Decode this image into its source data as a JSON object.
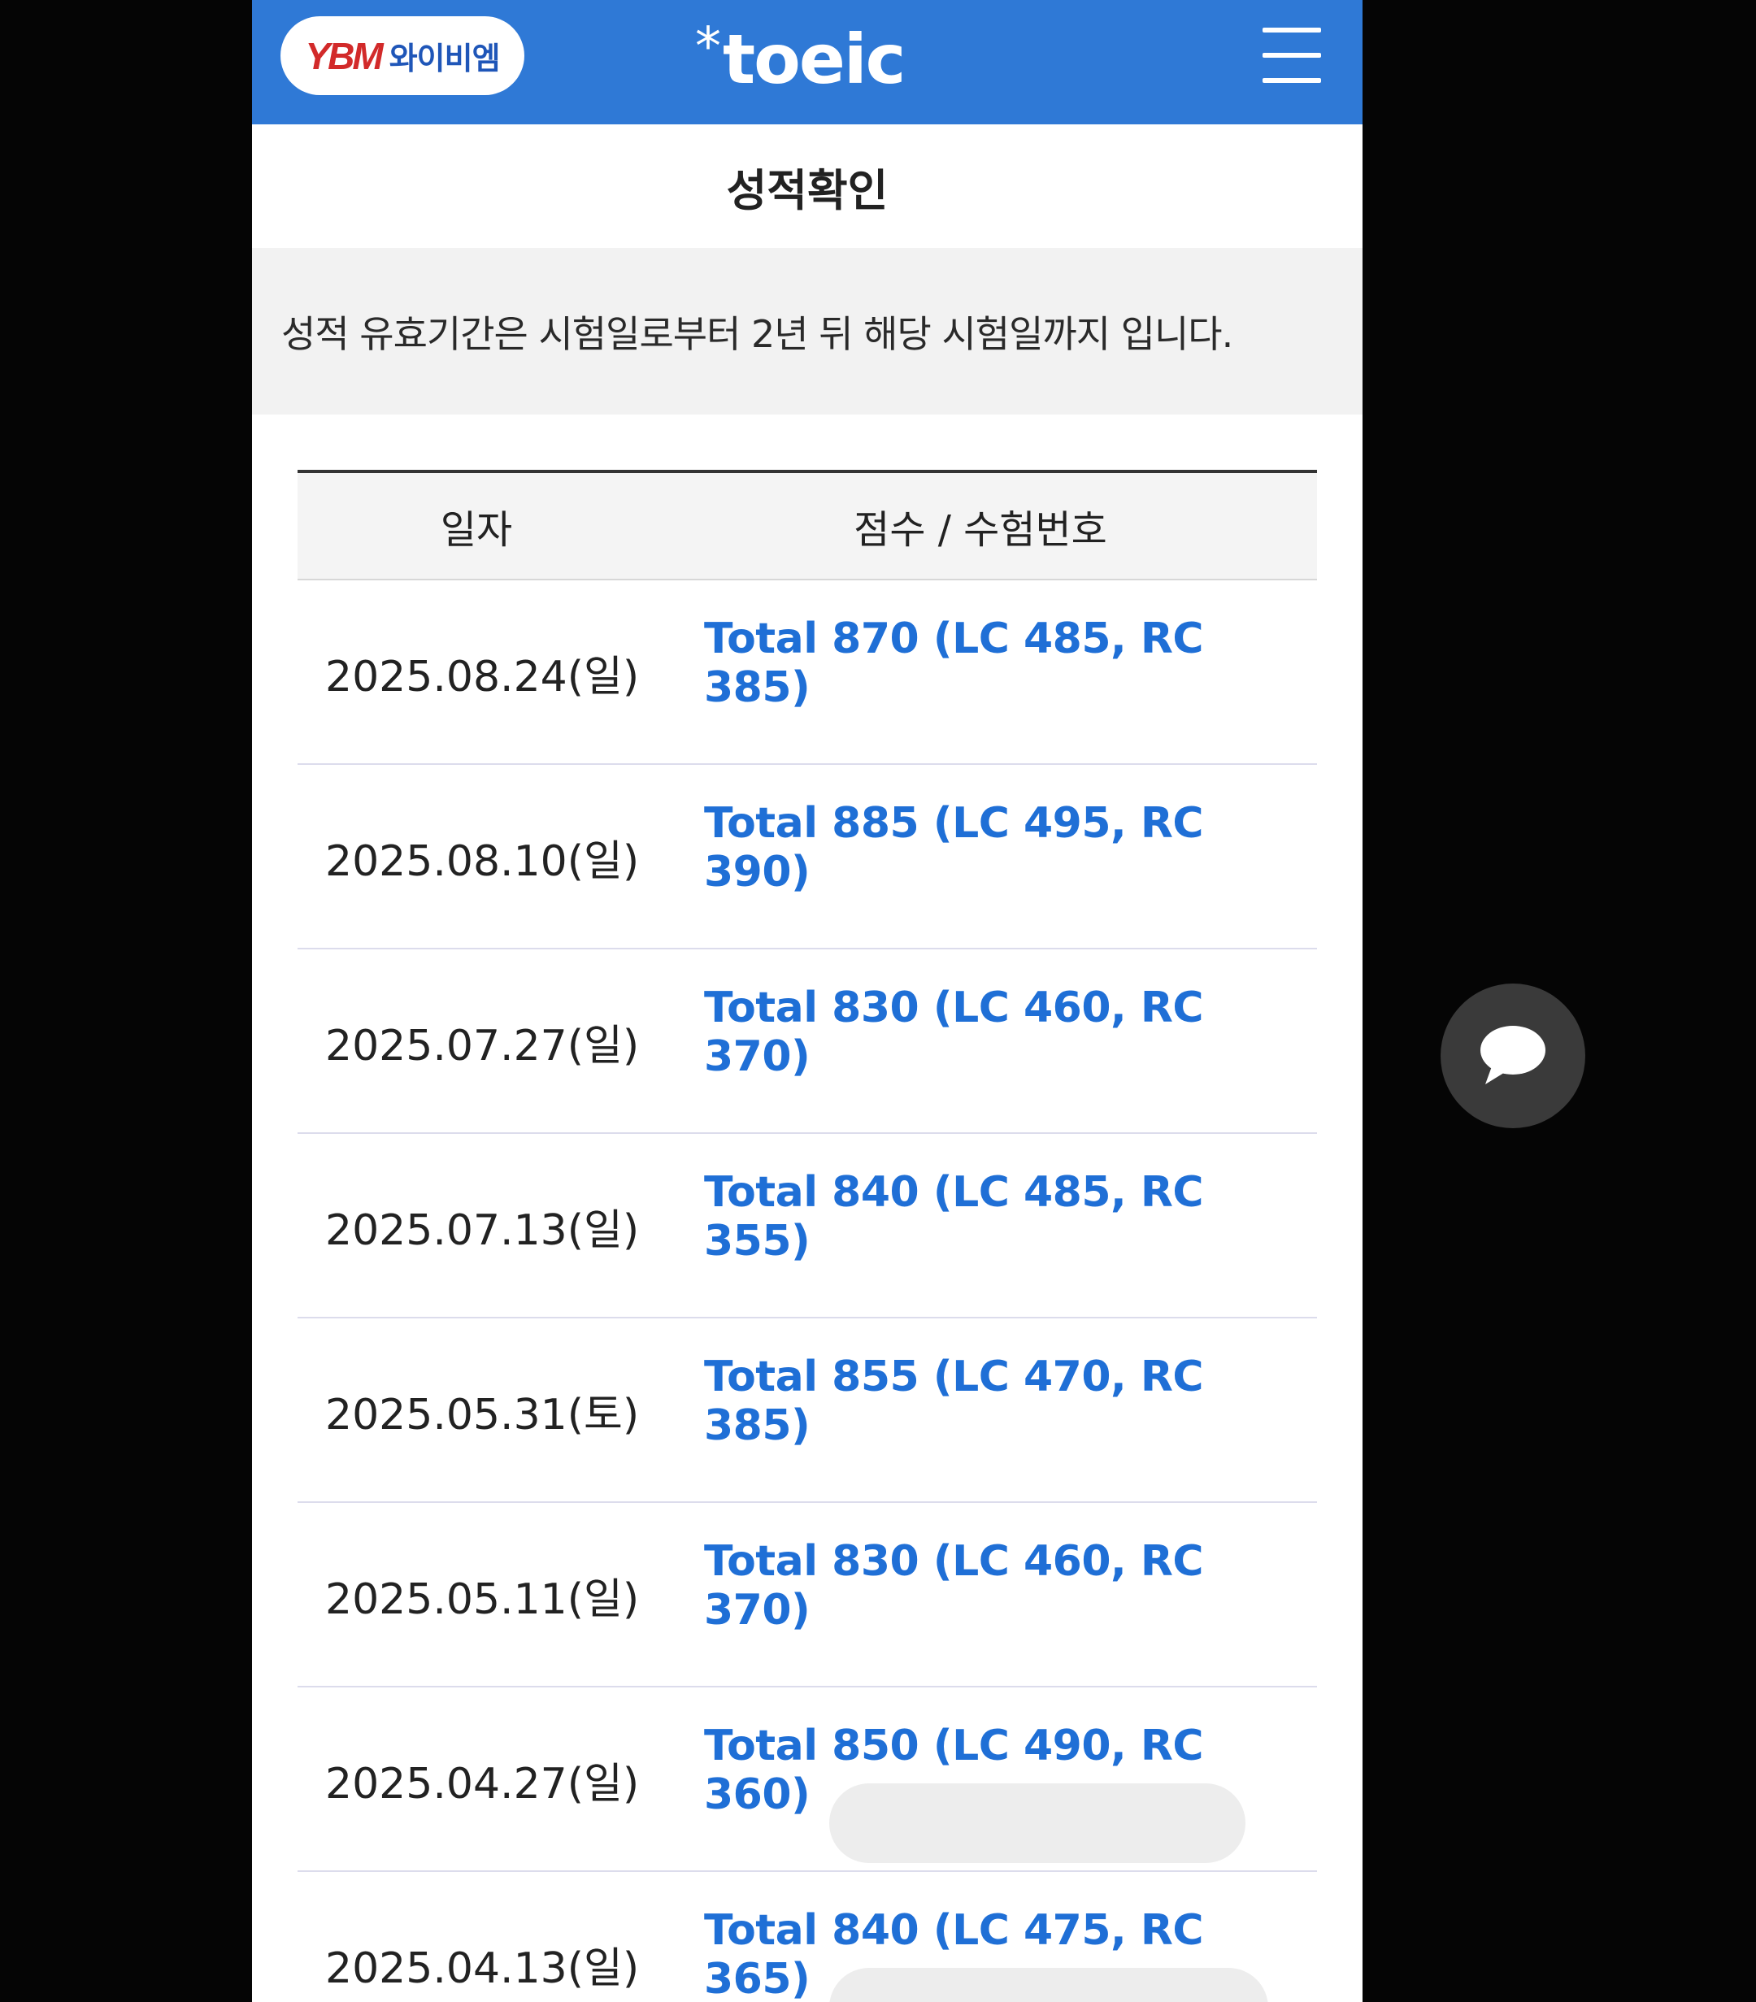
{
  "header": {
    "ybm_mark": "YBM",
    "ybm_text": "와이비엠",
    "brand_star": "*",
    "brand_word": "toeic"
  },
  "page_title": "성적확인",
  "notice": "성적 유효기간은 시험일로부터 2년 뒤 해당 시험일까지 입니다.",
  "table": {
    "columns": [
      "일자",
      "점수 / 수험번호"
    ],
    "rows": [
      {
        "date": "2025.08.24(일)",
        "score": "Total 870 (LC 485, RC 385)"
      },
      {
        "date": "2025.08.10(일)",
        "score": "Total 885 (LC 495, RC 390)"
      },
      {
        "date": "2025.07.27(일)",
        "score": "Total 830 (LC 460, RC 370)"
      },
      {
        "date": "2025.07.13(일)",
        "score": "Total 840 (LC 485, RC 355)"
      },
      {
        "date": "2025.05.31(토)",
        "score": "Total 855 (LC 470, RC 385)"
      },
      {
        "date": "2025.05.11(일)",
        "score": "Total 830 (LC 460, RC 370)"
      },
      {
        "date": "2025.04.27(일)",
        "score": "Total 850 (LC 490, RC 360)"
      },
      {
        "date": "2025.04.13(일)",
        "score": "Total 840 (LC 475, RC 365)"
      }
    ]
  },
  "colors": {
    "header_blue": "#2f79d6",
    "score_blue": "#1f6fd6",
    "ybm_red": "#d22a2a"
  },
  "icons": {
    "menu": "hamburger-icon",
    "chat": "chat-bubble-icon"
  }
}
